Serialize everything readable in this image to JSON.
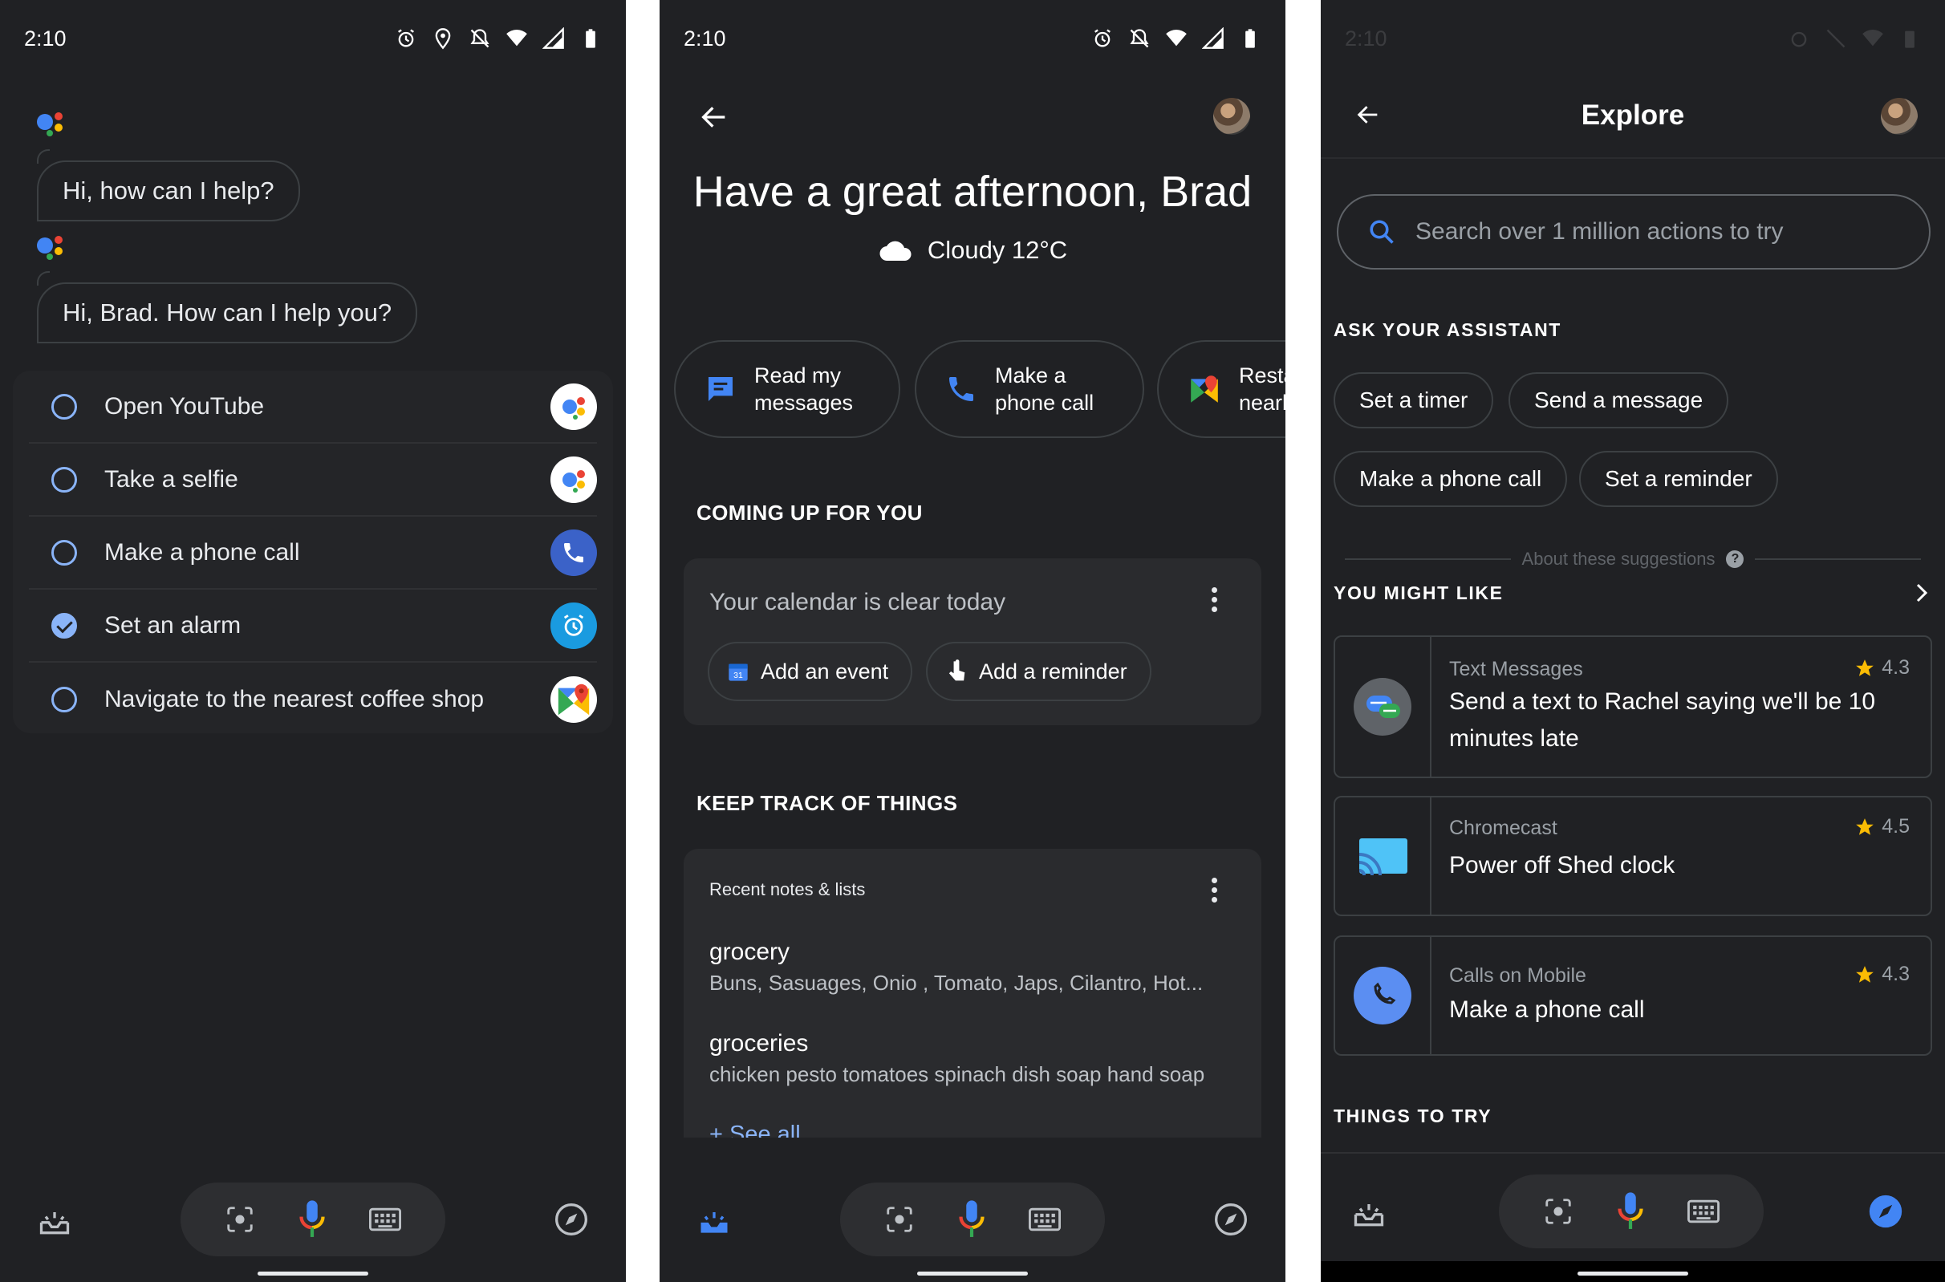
{
  "status": {
    "time": "2:10"
  },
  "screen1": {
    "bubble1": "Hi, how can I help?",
    "bubble2": "Hi, Brad. How can I help you?",
    "suggestions": [
      {
        "label": "Open YouTube",
        "icon": "assistant-icon",
        "checked": false
      },
      {
        "label": "Take a selfie",
        "icon": "assistant-icon",
        "checked": false
      },
      {
        "label": "Make a phone call",
        "icon": "phone-icon",
        "checked": false
      },
      {
        "label": "Set an alarm",
        "icon": "alarm-icon",
        "checked": true
      },
      {
        "label": "Navigate to the nearest coffee shop",
        "icon": "maps-icon",
        "checked": false
      }
    ]
  },
  "screen2": {
    "greeting": "Have a great afternoon, Brad",
    "weather": "Cloudy 12°C",
    "chips": [
      {
        "label": "Read my\nmessages",
        "icon": "messages-icon"
      },
      {
        "label": "Make a\nphone call",
        "icon": "phone-icon"
      },
      {
        "label": "Resta\nnearb",
        "icon": "maps-icon"
      }
    ],
    "coming_up": {
      "section": "COMING UP FOR YOU",
      "calendar_text": "Your calendar is clear today",
      "add_event": "Add an event",
      "add_reminder": "Add a reminder"
    },
    "keep_track": {
      "section": "KEEP TRACK OF THINGS",
      "card_title": "Recent notes & lists",
      "notes": [
        {
          "title": "grocery",
          "body": "Buns, Sasuages, Onio , Tomato, Japs, Cilantro, Hot..."
        },
        {
          "title": "groceries",
          "body": "chicken pesto tomatoes spinach dish soap hand soap"
        }
      ],
      "see_all": "+ See all"
    }
  },
  "screen3": {
    "title": "Explore",
    "search_placeholder": "Search over 1 million actions to try",
    "ask_section": "ASK YOUR ASSISTANT",
    "ask_chips": [
      "Set a timer",
      "Send a message",
      "Make a phone call",
      "Set a reminder"
    ],
    "about": "About these suggestions",
    "might_like_section": "YOU MIGHT LIKE",
    "actions": [
      {
        "app": "Text Messages",
        "rating": "4.3",
        "desc": "Send a text to Rachel saying we'll be 10 minutes late",
        "icon": "text-messages-icon"
      },
      {
        "app": "Chromecast",
        "rating": "4.5",
        "desc": "Power off Shed clock",
        "icon": "chromecast-icon"
      },
      {
        "app": "Calls on Mobile",
        "rating": "4.3",
        "desc": "Make a phone call",
        "icon": "phone-icon"
      }
    ],
    "things_section": "THINGS TO TRY"
  },
  "colors": {
    "background": "#202124",
    "accent_blue": "#8ab4f8",
    "google_blue": "#4285f4",
    "google_red": "#ea4335",
    "google_yellow": "#fbbc04",
    "google_green": "#34a853",
    "star": "#fbbc04"
  }
}
